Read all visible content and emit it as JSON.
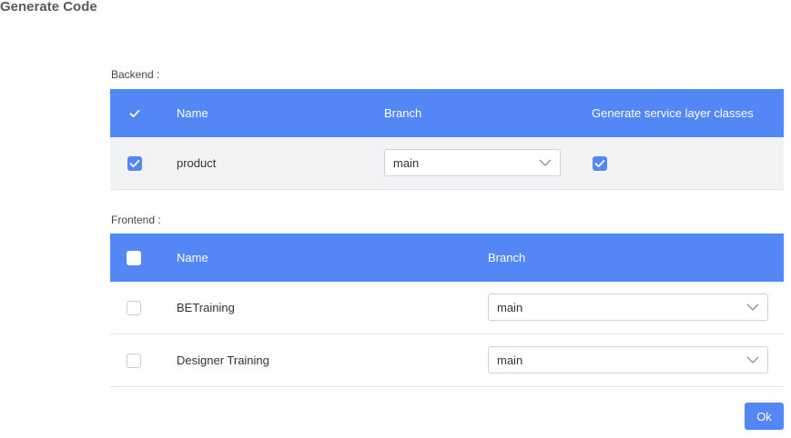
{
  "page": {
    "title": "Generate Code"
  },
  "backend": {
    "label": "Backend :",
    "headers": {
      "name": "Name",
      "branch": "Branch",
      "service_layer": "Generate service layer classes"
    },
    "rows": [
      {
        "name": "product",
        "branch": "main",
        "selected": true,
        "service_layer": true
      }
    ]
  },
  "frontend": {
    "label": "Frontend :",
    "headers": {
      "name": "Name",
      "branch": "Branch"
    },
    "rows": [
      {
        "name": "BETraining",
        "branch": "main",
        "selected": false
      },
      {
        "name": "Designer Training",
        "branch": "main",
        "selected": false
      }
    ]
  },
  "actions": {
    "ok_label": "Ok"
  },
  "colors": {
    "accent": "#5387f5",
    "row_alt": "#f2f3f5"
  },
  "icons": {
    "check": "check-icon",
    "dropdown": "chevron-down-icon"
  }
}
